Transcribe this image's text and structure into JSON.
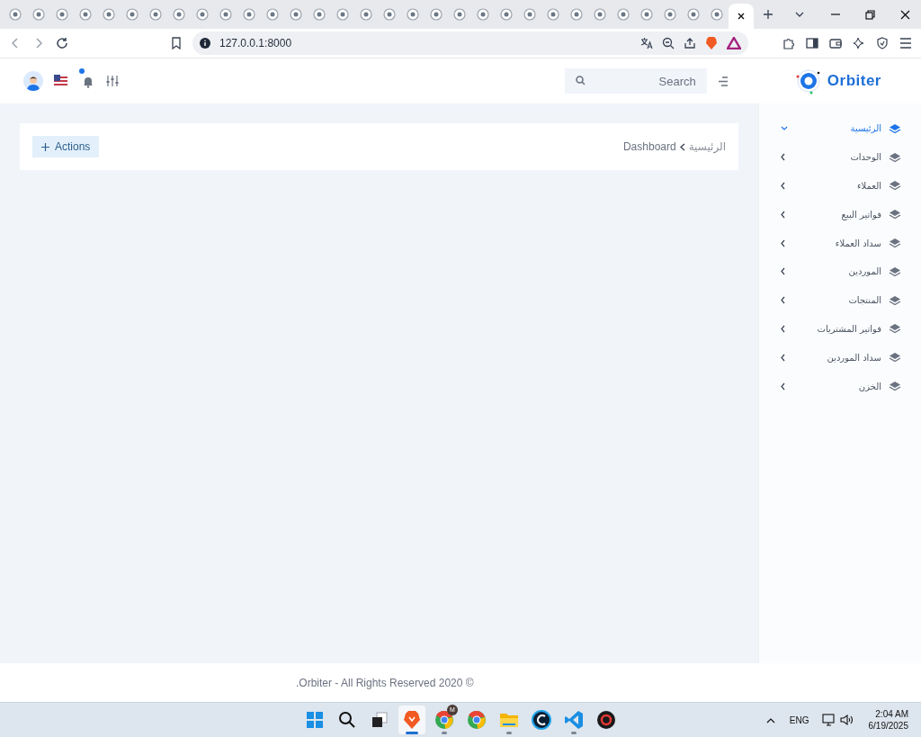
{
  "browser": {
    "tabs": [
      {
        "selected": false
      },
      {
        "selected": false
      },
      {
        "selected": false
      },
      {
        "selected": false
      },
      {
        "selected": false
      },
      {
        "selected": false
      },
      {
        "selected": false
      },
      {
        "selected": false
      },
      {
        "selected": false
      },
      {
        "selected": false
      },
      {
        "selected": false
      },
      {
        "selected": false
      },
      {
        "selected": false
      },
      {
        "selected": false
      },
      {
        "selected": false
      },
      {
        "selected": false
      },
      {
        "selected": false
      },
      {
        "selected": false
      },
      {
        "selected": false
      },
      {
        "selected": false
      },
      {
        "selected": false
      },
      {
        "selected": false
      },
      {
        "selected": false
      },
      {
        "selected": false
      },
      {
        "selected": false
      },
      {
        "selected": false
      },
      {
        "selected": false
      },
      {
        "selected": false
      },
      {
        "selected": false
      },
      {
        "selected": false
      },
      {
        "selected": false
      },
      {
        "selected": true
      }
    ],
    "address": "127.0.0.1:8000"
  },
  "header": {
    "search": {
      "placeholder": "Search"
    },
    "brand": "Orbiter",
    "notification_unread": true
  },
  "sidebar": {
    "items": [
      {
        "label": "الرئيسية",
        "selected": true,
        "expanded": true
      },
      {
        "label": "الوحدات",
        "selected": false,
        "expanded": false
      },
      {
        "label": "العملاء",
        "selected": false,
        "expanded": false
      },
      {
        "label": "فواتير البيع",
        "selected": false,
        "expanded": false
      },
      {
        "label": "سداد العملاء",
        "selected": false,
        "expanded": false
      },
      {
        "label": "الموردين",
        "selected": false,
        "expanded": false
      },
      {
        "label": "المنتجات",
        "selected": false,
        "expanded": false
      },
      {
        "label": "فواتير المشتريات",
        "selected": false,
        "expanded": false
      },
      {
        "label": "سداد الموردين",
        "selected": false,
        "expanded": false
      },
      {
        "label": "الخزن",
        "selected": false,
        "expanded": false
      }
    ]
  },
  "breadcrumb": [
    "الرئيسية",
    "Dashboard"
  ],
  "actions_button": "Actions",
  "footer": ".Orbiter - All Rights Reserved 2020 ©",
  "taskbar": {
    "apps": [
      {
        "kind": "start",
        "selected": false,
        "running": false
      },
      {
        "kind": "search",
        "selected": false,
        "running": false
      },
      {
        "kind": "taskview",
        "selected": false,
        "running": false
      },
      {
        "kind": "brave",
        "selected": true,
        "running": true
      },
      {
        "kind": "chrome",
        "selected": false,
        "running": true,
        "badge": "M"
      },
      {
        "kind": "chrome",
        "selected": false,
        "running": false
      },
      {
        "kind": "files",
        "selected": false,
        "running": true
      },
      {
        "kind": "cleaner",
        "selected": false,
        "running": false
      },
      {
        "kind": "vscode",
        "selected": false,
        "running": true
      },
      {
        "kind": "redgear",
        "selected": false,
        "running": false
      }
    ],
    "language": "ENG",
    "time": "2:04 AM",
    "date": "6/19/2025"
  }
}
